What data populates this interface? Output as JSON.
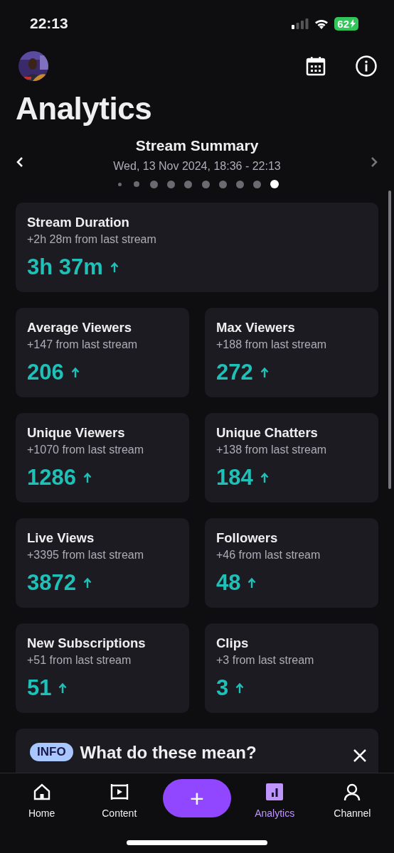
{
  "status_bar": {
    "time": "22:13",
    "battery": "62"
  },
  "header": {
    "title": "Analytics"
  },
  "summary": {
    "title": "Stream Summary",
    "date": "Wed, 13 Nov 2024, 18:36 - 22:13",
    "pages": [
      {
        "selected": false
      },
      {
        "selected": false
      },
      {
        "selected": false
      },
      {
        "selected": false
      },
      {
        "selected": false
      },
      {
        "selected": false
      },
      {
        "selected": false
      },
      {
        "selected": false
      },
      {
        "selected": false
      },
      {
        "selected": true
      }
    ]
  },
  "metrics": [
    {
      "title": "Stream Duration",
      "change": "+2h 28m from last stream",
      "value": "3h 37m",
      "wide": true
    },
    {
      "title": "Average Viewers",
      "change": "+147 from last stream",
      "value": "206",
      "wide": false
    },
    {
      "title": "Max Viewers",
      "change": "+188 from last stream",
      "value": "272",
      "wide": false
    },
    {
      "title": "Unique Viewers",
      "change": "+1070 from last stream",
      "value": "1286",
      "wide": false
    },
    {
      "title": "Unique Chatters",
      "change": "+138 from last stream",
      "value": "184",
      "wide": false
    },
    {
      "title": "Live Views",
      "change": "+3395 from last stream",
      "value": "3872",
      "wide": false
    },
    {
      "title": "Followers",
      "change": "+46 from last stream",
      "value": "48",
      "wide": false
    },
    {
      "title": "New Subscriptions",
      "change": "+51 from last stream",
      "value": "51",
      "wide": false
    },
    {
      "title": "Clips",
      "change": "+3 from last stream",
      "value": "3",
      "wide": false
    }
  ],
  "info_card": {
    "tag": "INFO",
    "title": "What do these mean?"
  },
  "nav": [
    {
      "kind": "home",
      "label": "Home",
      "selected": false
    },
    {
      "kind": "content",
      "label": "Content",
      "selected": false
    },
    {
      "kind": "create",
      "label": "+"
    },
    {
      "kind": "analytics",
      "label": "Analytics",
      "selected": true
    },
    {
      "kind": "channel",
      "label": "Channel",
      "selected": false
    }
  ]
}
